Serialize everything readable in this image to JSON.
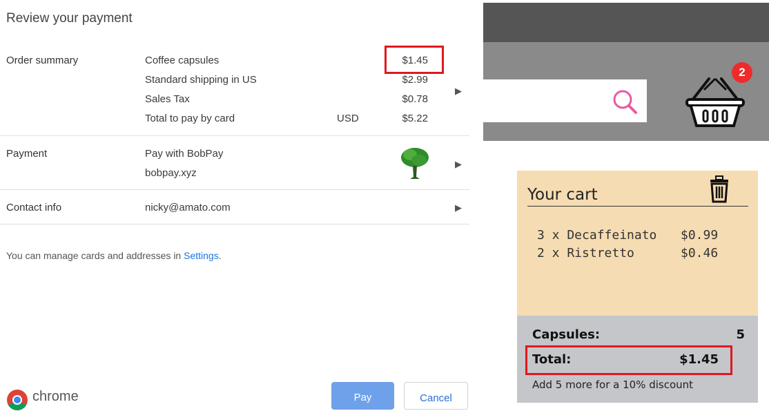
{
  "dialog": {
    "title": "Review your payment",
    "order_summary": {
      "label": "Order summary",
      "items": [
        {
          "name": "Coffee capsules",
          "amount": "$1.45"
        },
        {
          "name": "Standard shipping in US",
          "amount": "$2.99"
        },
        {
          "name": "Sales Tax",
          "amount": "$0.78"
        }
      ],
      "total": {
        "name": "Total to pay by card",
        "currency": "USD",
        "amount": "$5.22"
      }
    },
    "payment": {
      "label": "Payment",
      "line1": "Pay with BobPay",
      "line2": "bobpay.xyz",
      "icon": "tree-icon"
    },
    "contact": {
      "label": "Contact info",
      "email": "nicky@amato.com"
    },
    "manage_text": "You can manage cards and addresses in ",
    "settings_link": "Settings",
    "settings_suffix": ".",
    "brand": "chrome",
    "buttons": {
      "pay": "Pay",
      "cancel": "Cancel"
    },
    "colors": {
      "highlight": "#e0181f",
      "link": "#1a73e8",
      "pay_button": "#6fa0ea"
    }
  },
  "shop": {
    "cart_badge_count": "2",
    "cart": {
      "title": "Your cart",
      "items": [
        {
          "name": "3 x Decaffeinato",
          "price": "$0.99"
        },
        {
          "name": "2 x Ristretto",
          "price": "$0.46"
        }
      ],
      "capsules_label": "Capsules:",
      "capsules_value": "5",
      "total_label": "Total:",
      "total_value": "$1.45",
      "note": "Add 5 more for a 10% discount"
    },
    "colors": {
      "cart_bg": "#f6dcb2",
      "footer_bg": "#c4c6ca",
      "badge": "#ee2b2b",
      "search_icon": "#e85aa0"
    }
  }
}
